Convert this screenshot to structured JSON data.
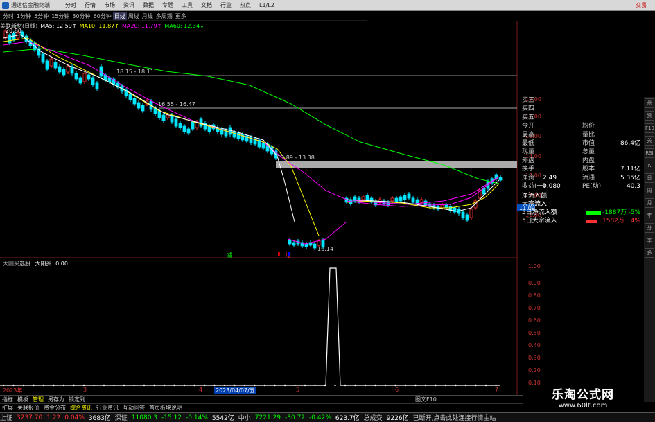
{
  "app": {
    "title": "通达信金融终端",
    "trade_button": "交易"
  },
  "menu": [
    "分时",
    "行情",
    "市场",
    "资讯",
    "数据",
    "专题",
    "工具",
    "文档",
    "行业",
    "热点",
    "L1/L2"
  ],
  "periods": [
    "分时",
    "1分钟",
    "5分钟",
    "15分钟",
    "30分钟",
    "60分钟",
    "日线",
    "周线",
    "月线",
    "多周期",
    "更多"
  ],
  "active_period": "日线",
  "ma_line": {
    "stock": "美联新材(日线)",
    "ma5": "MA5: 12.59↑",
    "ma10": "MA10: 11.87↑",
    "ma20": "MA20: 11.79↑",
    "ma60": "MA60: 12.34↓"
  },
  "colors": {
    "ma5": "#ffffff",
    "ma10": "#ffff00",
    "ma20": "#ff00ff",
    "ma60": "#00ff00",
    "up": "#ff3333",
    "down": "#00ffff",
    "ind_line": "#ffffff"
  },
  "annotations": {
    "high": "20.80",
    "box1": "18.15 - 18.11",
    "box2": "16.55 - 16.47",
    "box3": "13.89 - 13.38",
    "low": "10.14",
    "marker_green": "减",
    "marker_red": "增"
  },
  "price_axis": [
    "17.00",
    "16.00",
    "15.00",
    "14.00",
    "13.00",
    "12.00",
    "11.00"
  ],
  "current_price": "11.09",
  "quote_panel": {
    "rows": [
      {
        "l1": "买三",
        "v1": "",
        "l2": "",
        "v2": ""
      },
      {
        "l1": "买四",
        "v1": "",
        "l2": "",
        "v2": ""
      },
      {
        "l1": "买五",
        "v1": "",
        "l2": "",
        "v2": ""
      },
      {
        "l1": "今开",
        "v1": "",
        "l2": "均价",
        "v2": ""
      },
      {
        "l1": "最高",
        "v1": "",
        "l2": "量比",
        "v2": ""
      },
      {
        "l1": "最低",
        "v1": "",
        "l2": "市值",
        "v2": "86.4亿"
      },
      {
        "l1": "现量",
        "v1": "",
        "l2": "总量",
        "v2": ""
      },
      {
        "l1": "外盘",
        "v1": "",
        "l2": "内盘",
        "v2": ""
      },
      {
        "l1": "换手",
        "v1": "",
        "l2": "股本",
        "v2": "7.11亿"
      },
      {
        "l1": "净资",
        "v1": "2.49",
        "l2": "流通",
        "v2": "5.35亿"
      },
      {
        "l1": "收益(一)",
        "v1": "0.080",
        "l2": "PE(动)",
        "v2": "40.3"
      }
    ],
    "flow": [
      {
        "label": "净流入额",
        "value": "",
        "pct": ""
      },
      {
        "label": "大宗流入",
        "value": "",
        "pct": ""
      },
      {
        "label": "5日净流入额",
        "value": "-1887万",
        "pct": "-5%"
      },
      {
        "label": "5日大宗流入",
        "value": "1582万",
        "pct": "4%"
      }
    ]
  },
  "indicator": {
    "name": "大阳买选股",
    "label": "大阳买",
    "value": "0.00",
    "axis": [
      "1.00",
      "0.90",
      "0.80",
      "0.70",
      "0.60",
      "0.50",
      "0.40",
      "0.30",
      "0.20",
      "0.10"
    ]
  },
  "date_bar": {
    "year": "2023年",
    "m3": "3",
    "m4": "4",
    "selected": "2023/04/07/五",
    "m5": "5",
    "m6": "6",
    "m7": "7"
  },
  "bottom_tabs": [
    "指标",
    "模板",
    "管理",
    "另存为",
    "锁定到",
    "扩展",
    "关联报价",
    "资金分布",
    "综合资讯",
    "行业资讯",
    "互动问答",
    "首页板块说明"
  ],
  "bottom_right": "图文F10",
  "status": [
    {
      "name": "上证",
      "price": "3237.70",
      "chg": "1.22",
      "pct": "0.04%",
      "amt": "3683亿"
    },
    {
      "name": "深证",
      "price": "11080.3",
      "chg": "-15.12",
      "pct": "-0.14%",
      "amt": "5542亿"
    },
    {
      "name": "中小",
      "price": "7221.29",
      "chg": "-30.72",
      "pct": "-0.42%",
      "amt": "623.7亿"
    }
  ],
  "status_extra": {
    "label": "总成交",
    "value": "9226亿",
    "notice": "已断开,点击此处连接行情主站"
  },
  "watermark": {
    "cn": "乐淘公式网",
    "url": "www.60lt.com"
  },
  "right_tools": [
    "盘",
    "资",
    "F10",
    "关",
    "RSI",
    "K",
    "日",
    "周",
    "月",
    "年",
    "分",
    "季",
    "多"
  ]
}
